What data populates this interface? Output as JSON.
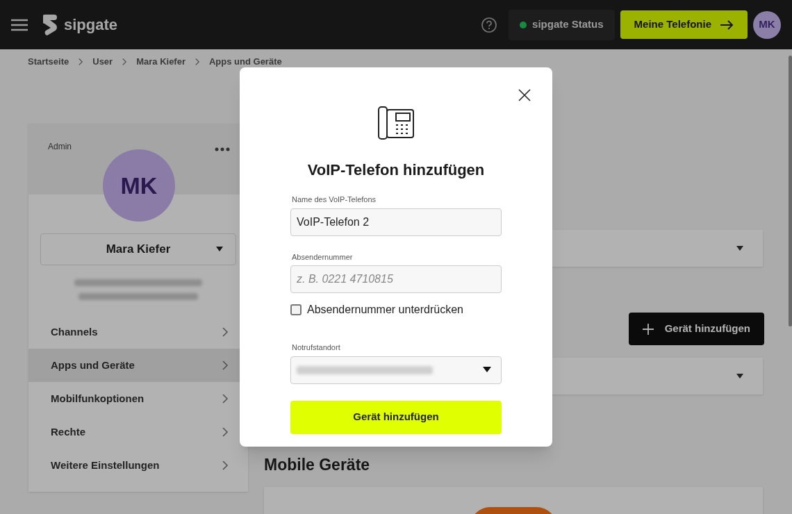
{
  "header": {
    "logo": "sipgate",
    "status_button": "sipgate Status",
    "status_ok": true,
    "primary_button": "Meine Telefonie",
    "avatar": "MK"
  },
  "breadcrumb": [
    "Startseite",
    "User",
    "Mara Kiefer",
    "Apps und Geräte"
  ],
  "profile": {
    "role": "Admin",
    "avatar": "MK",
    "name": "Mara Kiefer"
  },
  "sidebar": {
    "items": [
      {
        "label": "Channels",
        "selected": false
      },
      {
        "label": "Apps und Geräte",
        "selected": true
      },
      {
        "label": "Mobilfunkoptionen",
        "selected": false
      },
      {
        "label": "Rechte",
        "selected": false
      },
      {
        "label": "Weitere Einstellungen",
        "selected": false
      }
    ]
  },
  "content": {
    "add_button": "Gerät hinzufügen",
    "section_title": "Mobile Geräte"
  },
  "dialog": {
    "title": "VoIP-Telefon hinzufügen",
    "fields": [
      {
        "kind": "text",
        "label": "Name des VoIP-Telefons",
        "value": "VoIP-Telefon 2"
      },
      {
        "kind": "text",
        "label": "Absendernummer",
        "placeholder": "z. B. 0221 4710815"
      },
      {
        "kind": "checkbox",
        "label": "Absendernummer unterdrücken",
        "checked": false
      },
      {
        "kind": "select",
        "label": "Notrufstandort"
      }
    ],
    "submit": "Gerät hinzufügen"
  }
}
